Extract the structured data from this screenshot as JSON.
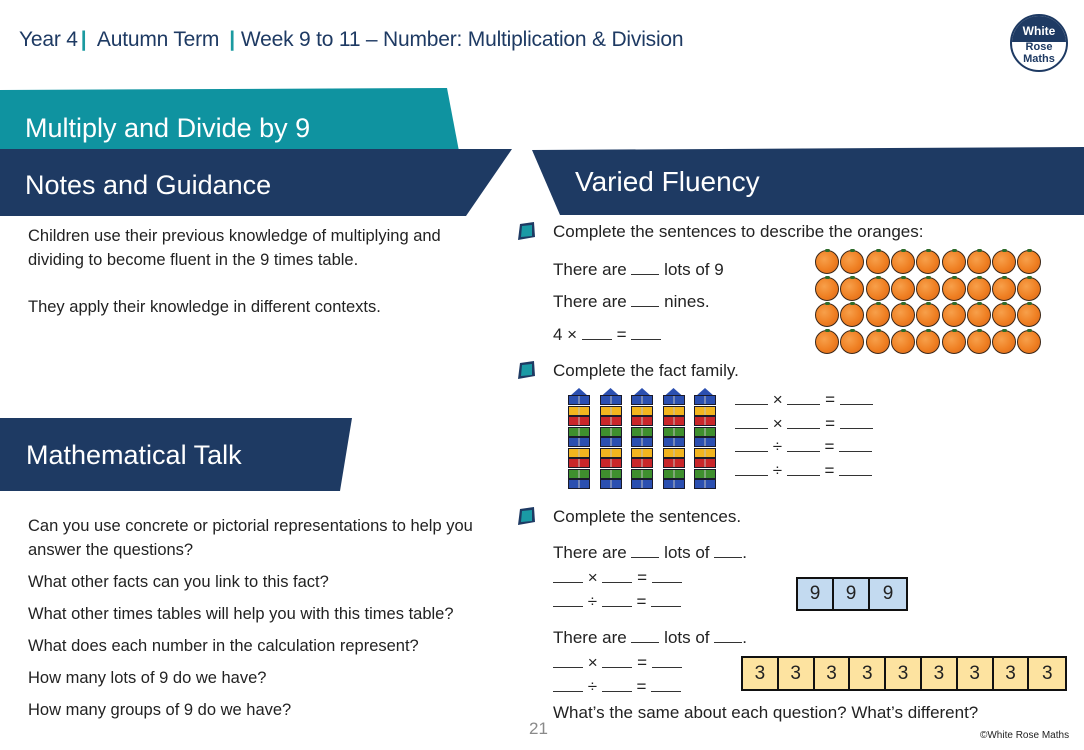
{
  "header": {
    "year": "Year 4",
    "term": "Autumn Term",
    "week": "Week 9 to 11 – Number: Multiplication & Division",
    "separator": "|"
  },
  "logo": {
    "line1": "White",
    "line2": "Rose",
    "line3": "Maths"
  },
  "title": "Multiply and Divide by 9",
  "notes": {
    "heading": "Notes and Guidance",
    "paragraphs": [
      "Children use their previous knowledge of multiplying and dividing to become fluent in the 9 times table.",
      "They apply their knowledge in different contexts."
    ]
  },
  "math_talk": {
    "heading": "Mathematical Talk",
    "questions": [
      "Can you use concrete or pictorial representations to help you answer the questions?",
      "What other facts can you link to this fact?",
      "What other times tables will help you with this times table?",
      "What does each number in the calculation represent?",
      "How many lots of 9 do we have?",
      "How many groups of 9 do we have?"
    ]
  },
  "varied_fluency": {
    "heading": "Varied Fluency",
    "q1": {
      "prompt": "Complete the sentences to describe the oranges:",
      "line1_a": "There are",
      "line1_b": "lots of 9",
      "line2_a": "There are",
      "line2_b": "nines.",
      "line3_a": "4 ×",
      "line3_eq": "=",
      "oranges_rows": 4,
      "oranges_cols": 9
    },
    "q2": {
      "prompt": "Complete the fact family.",
      "ops": [
        "×",
        "×",
        "÷",
        "÷"
      ],
      "eq": "=",
      "towers": 5,
      "cube_colors": [
        "#2b4fb0",
        "#f2b51f",
        "#c9262a",
        "#3f8f2e",
        "#2b4fb0",
        "#f2b51f",
        "#c9262a",
        "#3f8f2e",
        "#2b4fb0"
      ]
    },
    "q3": {
      "prompt": "Complete the sentences.",
      "part_a": {
        "sentence_a": "There are",
        "sentence_b": "lots of",
        "sentence_end": ".",
        "mult": "×",
        "div": "÷",
        "eq": "=",
        "bar_values": [
          "9",
          "9",
          "9"
        ]
      },
      "part_b": {
        "sentence_a": "There are",
        "sentence_b": "lots of",
        "sentence_end": ".",
        "mult": "×",
        "div": "÷",
        "eq": "=",
        "bar_values": [
          "3",
          "3",
          "3",
          "3",
          "3",
          "3",
          "3",
          "3",
          "3"
        ]
      },
      "closing": "What’s the same about each question?  What’s different?"
    }
  },
  "colors": {
    "navy": "#1e3a63",
    "teal": "#0f93a0",
    "bar_blue": "#c3daf0",
    "bar_yellow": "#fde3a0"
  },
  "footer": {
    "page_number": "21",
    "copyright": "©White Rose Maths"
  }
}
